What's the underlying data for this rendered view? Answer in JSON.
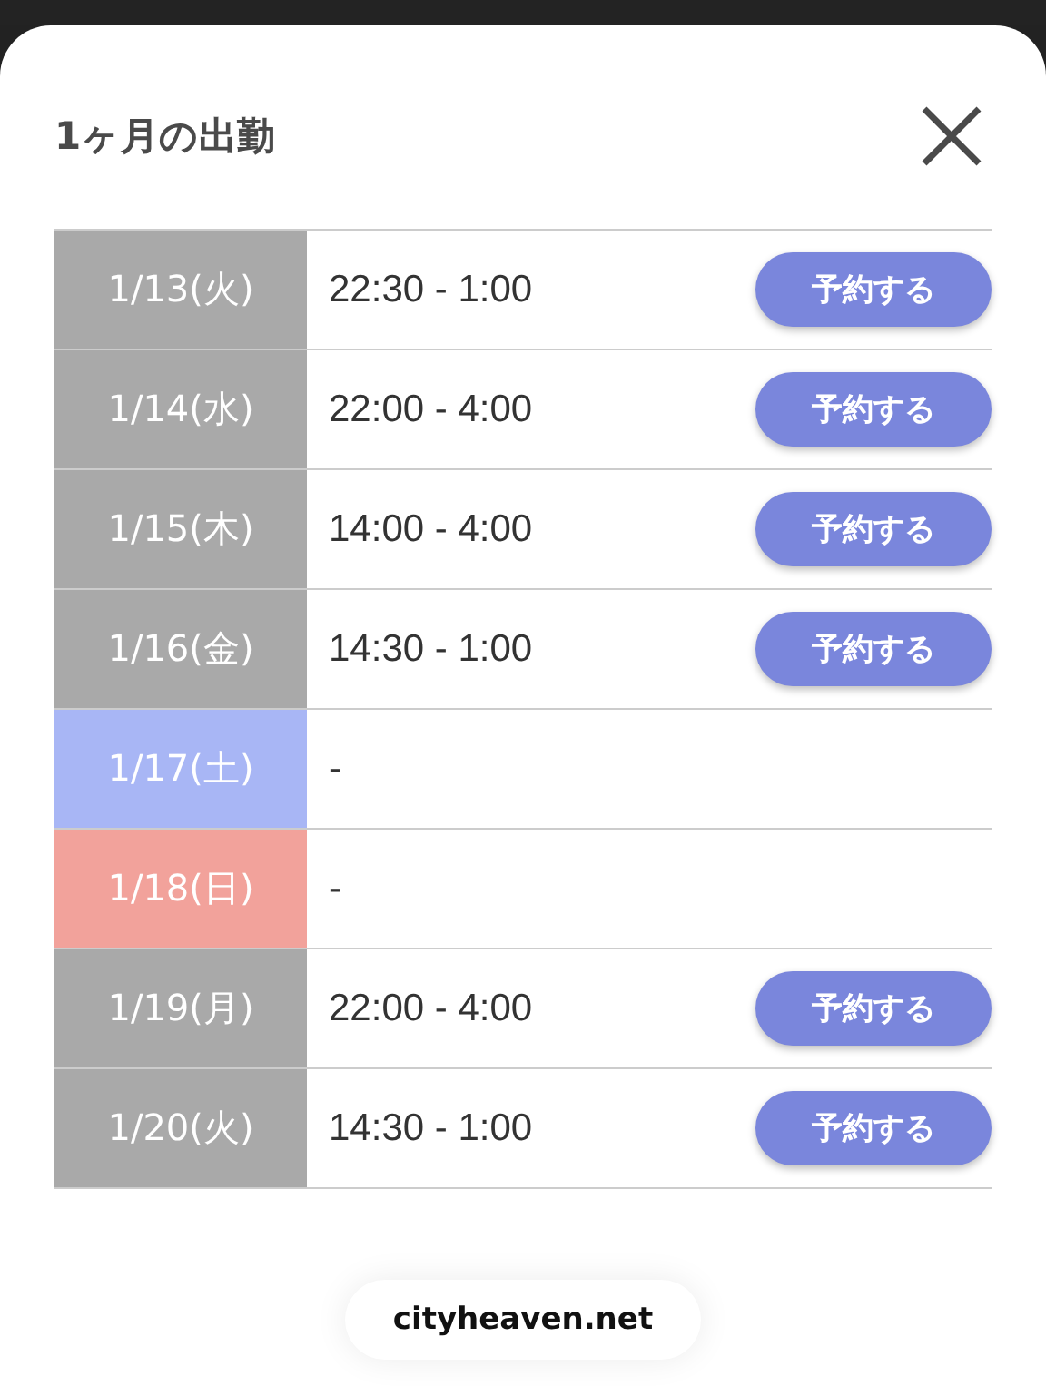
{
  "dialog": {
    "title": "1ヶ月の出勤"
  },
  "schedule": [
    {
      "date": "1/13(火)",
      "kind": "weekday",
      "hours": "22:30 - 1:00",
      "button": "予約する"
    },
    {
      "date": "1/14(水)",
      "kind": "weekday",
      "hours": "22:00 - 4:00",
      "button": "予約する"
    },
    {
      "date": "1/15(木)",
      "kind": "weekday",
      "hours": "14:00 - 4:00",
      "button": "予約する"
    },
    {
      "date": "1/16(金)",
      "kind": "weekday",
      "hours": "14:30 - 1:00",
      "button": "予約する"
    },
    {
      "date": "1/17(土)",
      "kind": "saturday",
      "hours": "-"
    },
    {
      "date": "1/18(日)",
      "kind": "sunday",
      "hours": "-"
    },
    {
      "date": "1/19(月)",
      "kind": "weekday",
      "hours": "22:00 - 4:00",
      "button": "予約する"
    },
    {
      "date": "1/20(火)",
      "kind": "weekday",
      "hours": "14:30 - 1:00",
      "button": "予約する"
    }
  ],
  "footer": {
    "domain": "cityheaven.net"
  }
}
